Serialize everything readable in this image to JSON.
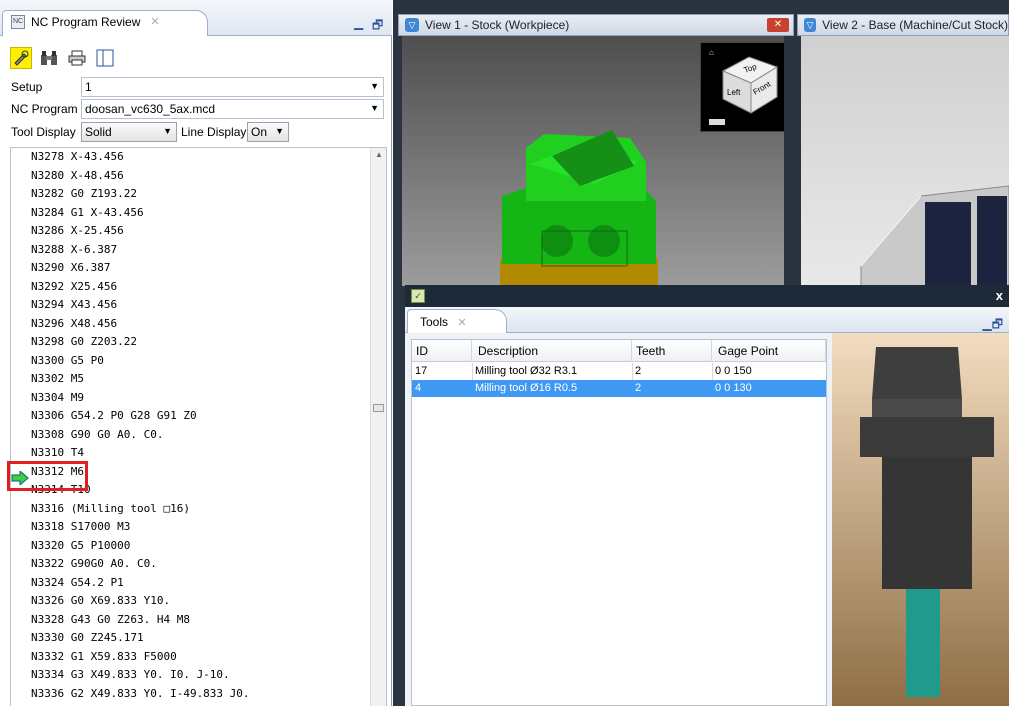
{
  "left_panel": {
    "tab_title": "NC Program Review",
    "setup_label": "Setup",
    "setup_value": "1",
    "program_label": "NC Program",
    "program_value": "doosan_vc630_5ax.mcd",
    "tool_display_label": "Tool Display",
    "tool_display_value": "Solid",
    "line_display_label": "Line Display",
    "line_display_value": "On",
    "code_lines": [
      "N3278 X-43.456",
      "N3280 X-48.456",
      "N3282 G0 Z193.22",
      "N3284 G1 X-43.456",
      "N3286 X-25.456",
      "N3288 X-6.387",
      "N3290 X6.387",
      "N3292 X25.456",
      "N3294 X43.456",
      "N3296 X48.456",
      "N3298 G0 Z203.22",
      "N3300 G5 P0",
      "N3302 M5",
      "N3304 M9",
      "N3306 G54.2 P0 G28 G91 Z0",
      "N3308 G90 G0 A0. C0.",
      "N3310 T4",
      "N3312 M6",
      "N3314 T10",
      "N3316 (Milling tool □16)",
      "N3318 S17000 M3",
      "N3320 G5 P10000",
      "N3322 G90G0 A0. C0.",
      "N3324 G54.2 P1",
      "N3326 G0 X69.833 Y10.",
      "N3328 G43 G0 Z263. H4 M8",
      "N3330 G0 Z245.171",
      "N3332 G1 X59.833 F5000",
      "N3334 G3 X49.833 Y0. I0. J-10.",
      "N3336 G2 X49.833 Y0. I-49.833 J0."
    ],
    "current_line_index": 17
  },
  "views": {
    "view1_title": "View 1 - Stock (Workpiece)",
    "view2_title": "View 2 - Base (Machine/Cut Stock)",
    "cube_labels": {
      "top": "Top",
      "left": "Left",
      "front": "Front"
    }
  },
  "tools": {
    "tab_title": "Tools",
    "columns": [
      "ID",
      "Description",
      "Teeth",
      "Gage Point"
    ],
    "rows": [
      [
        "17",
        "Milling tool Ø32 R3.1",
        "2",
        "0 0 150"
      ],
      [
        "4",
        "Milling tool Ø16 R0.5",
        "2",
        "0 0 130"
      ]
    ],
    "selected_row": 1
  },
  "colors": {
    "stock_green": "#1ec81e",
    "selection_blue": "#3f98f2",
    "highlight_yellow": "#ffef00",
    "marker_red": "#e02020",
    "tool_teal": "#1f9a8c"
  },
  "icons": [
    "nc-review-icon",
    "simulate-icon",
    "binoculars-icon",
    "print-icon",
    "split-view-icon",
    "current-line-arrow-icon",
    "close-icon",
    "maximize-icon",
    "minimize-icon"
  ]
}
